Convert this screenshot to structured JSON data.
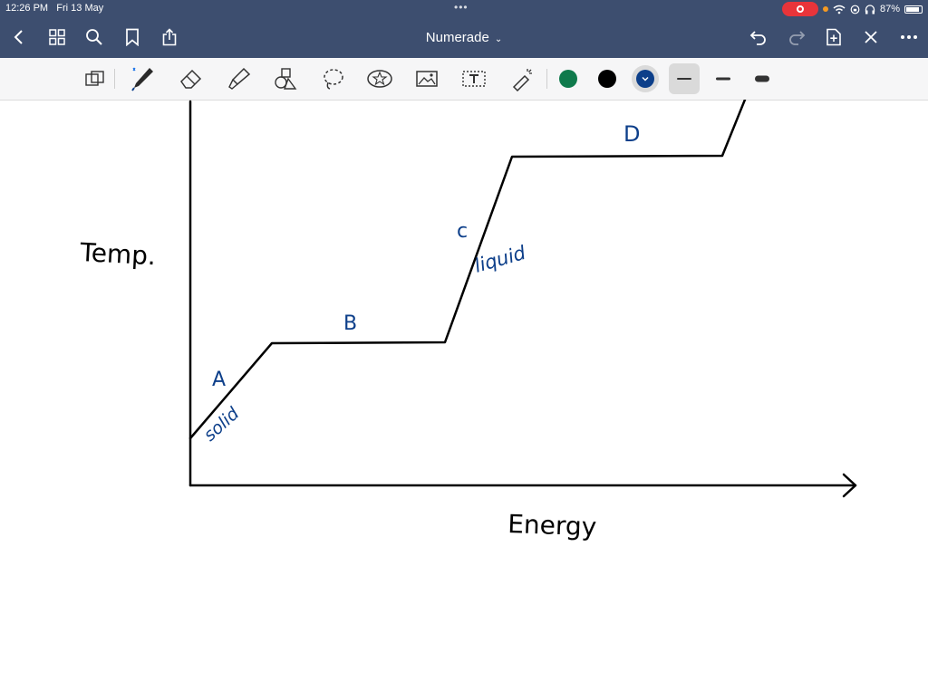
{
  "status_bar": {
    "time": "12:26 PM",
    "date": "Fri 13 May",
    "battery": "87%"
  },
  "nav": {
    "title": "Numerade"
  },
  "toolbar": {
    "tools": [
      "lasso-select-icon",
      "pen-icon",
      "eraser-icon",
      "highlighter-icon",
      "shapes-icon",
      "lasso-icon",
      "sticker-icon",
      "image-icon",
      "text-box-icon",
      "laser-pointer-icon"
    ],
    "colors": [
      "#0f7a4c",
      "#000000",
      "#0d3f8a"
    ],
    "selected_color": "#0d3f8a",
    "stroke_widths": [
      "thin",
      "medium",
      "thick"
    ]
  },
  "drawing": {
    "y_label": "Temp.",
    "x_label": "Energy",
    "segment_labels": {
      "a": "A",
      "b": "B",
      "c": "c",
      "d": "D"
    },
    "phase_labels": {
      "solid": "solid",
      "liquid": "liquid"
    },
    "ink_color": "#0d3f8a"
  }
}
